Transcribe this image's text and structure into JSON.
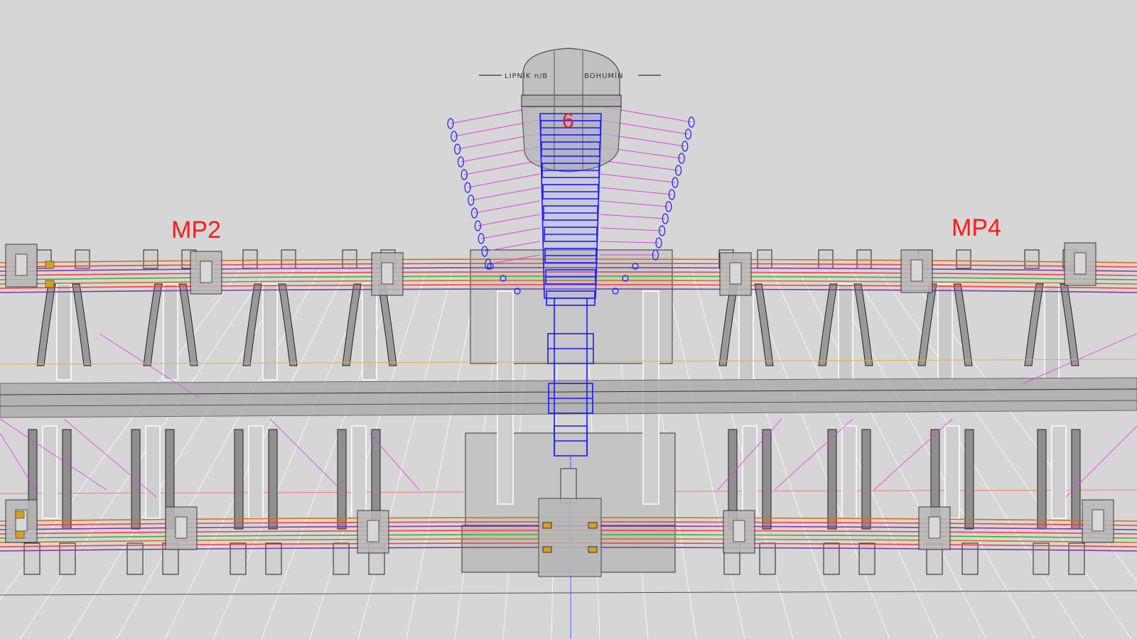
{
  "labels": {
    "left_marker": "MP2",
    "right_marker": "MP4",
    "direction_left": "LIPNÍK n/B",
    "direction_right": "BOHUMÍN",
    "switch_number": "6"
  },
  "colors": {
    "background": "#d6d6d6",
    "marker_text": "#ff1a1a",
    "drive_rod": "#1a1aff",
    "throw_lines": "#e040e0",
    "rail_red": "#ff3b3b",
    "rail_orange": "#c8741e",
    "rail_purple": "#7a3ea8",
    "rail_green": "#3fae3f",
    "sleeper_fill": "#9a9a9a",
    "outline": "#202020"
  }
}
